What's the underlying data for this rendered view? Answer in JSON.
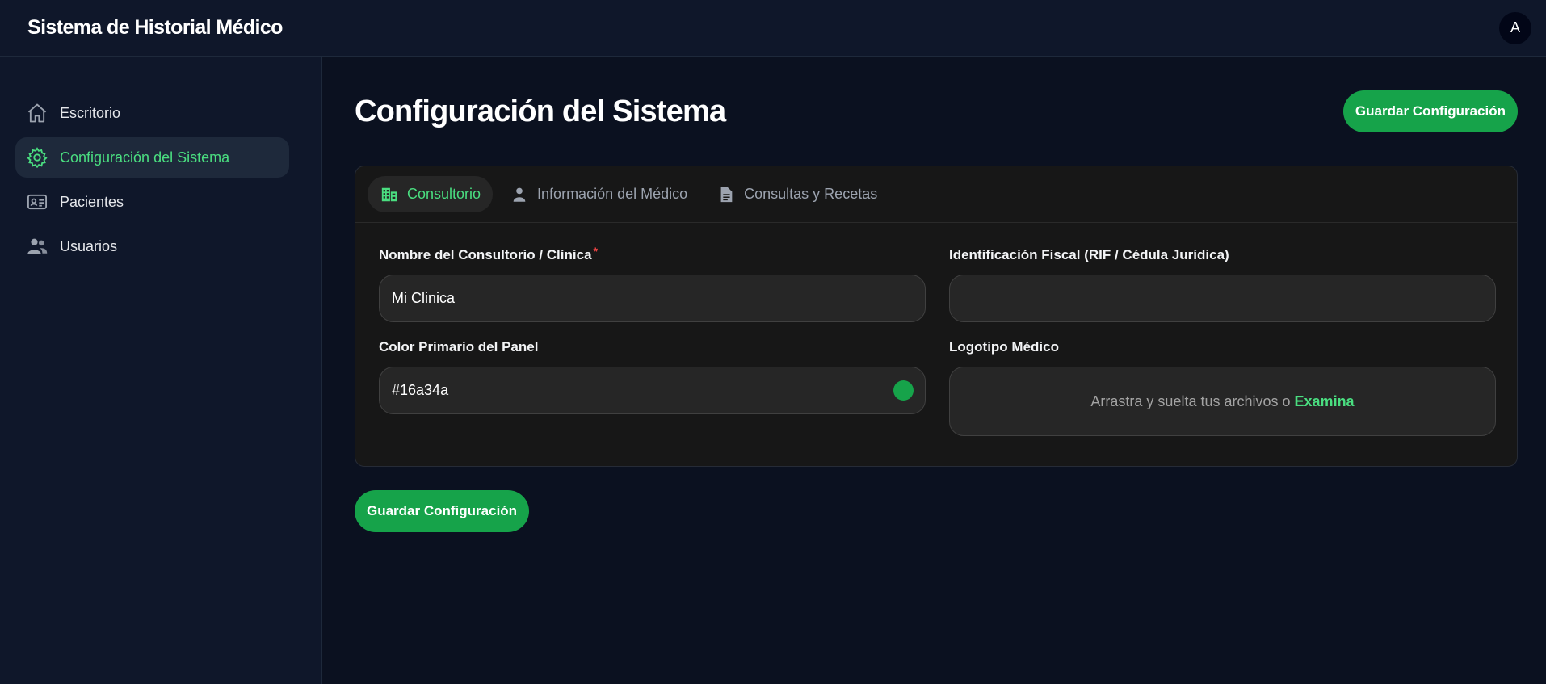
{
  "app": {
    "title": "Sistema de Historial Médico",
    "avatar_initial": "A"
  },
  "sidebar": {
    "items": [
      {
        "label": "Escritorio",
        "icon": "home-icon",
        "active": false
      },
      {
        "label": "Configuración del Sistema",
        "icon": "gear-icon",
        "active": true
      },
      {
        "label": "Pacientes",
        "icon": "id-card-icon",
        "active": false
      },
      {
        "label": "Usuarios",
        "icon": "users-icon",
        "active": false
      }
    ]
  },
  "page": {
    "title": "Configuración del Sistema",
    "save_label": "Guardar Configuración"
  },
  "tabs": [
    {
      "label": "Consultorio",
      "icon": "building-icon",
      "active": true
    },
    {
      "label": "Información del Médico",
      "icon": "user-icon",
      "active": false
    },
    {
      "label": "Consultas y Recetas",
      "icon": "document-icon",
      "active": false
    }
  ],
  "form": {
    "clinic_name": {
      "label": "Nombre del Consultorio / Clínica",
      "required_mark": "*",
      "value": "Mi Clinica"
    },
    "tax_id": {
      "label": "Identificación Fiscal (RIF / Cédula Jurídica)",
      "value": ""
    },
    "primary_color": {
      "label": "Color Primario del Panel",
      "value": "#16a34a"
    },
    "logo": {
      "label": "Logotipo Médico",
      "prompt": "Arrastra y suelta tus archivos o",
      "browse_label": "Examina"
    }
  },
  "colors": {
    "accent": "#16a34a",
    "accent_light": "#4ade80",
    "background": "#0b1120",
    "card": "#171717"
  }
}
